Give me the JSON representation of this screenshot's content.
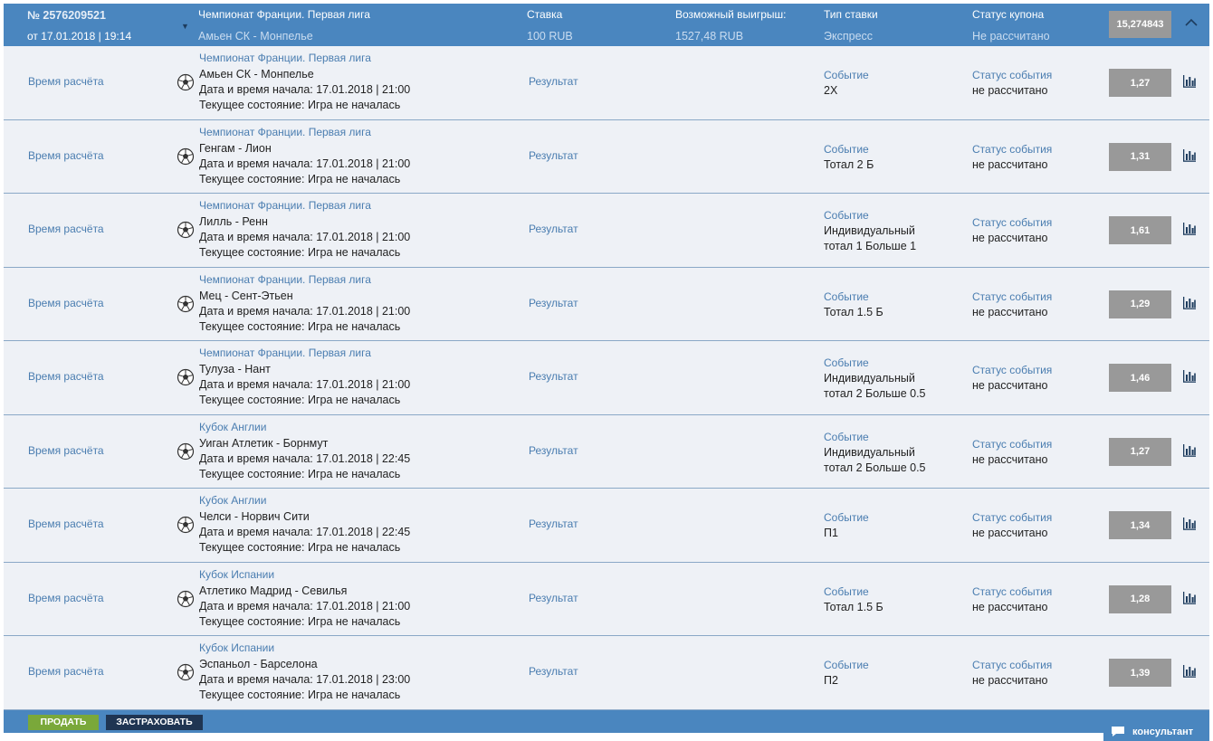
{
  "coupon": {
    "number": "№ 2576209521",
    "date": "от 17.01.2018 | 19:14",
    "col_event_label": "Чемпионат Франции. Первая лига",
    "col_event_value": "Амьен СК - Монпелье",
    "col_stake_label": "Ставка",
    "col_stake_value": "100 RUB",
    "col_win_label": "Возможный выигрыш:",
    "col_win_value": "1527,48 RUB",
    "col_type_label": "Тип ставки",
    "col_type_value": "Экспресс",
    "col_status_label": "Статус купона",
    "col_status_value": "Не рассчитано",
    "total_odds": "15,274843",
    "toggle_icon": "chevron-up-icon"
  },
  "labels": {
    "calc_time": "Время расчёта",
    "result": "Результат",
    "event": "Событие",
    "event_status": "Статус события",
    "start_prefix": "Дата и время начала: ",
    "state_prefix": "Текущее состояние: "
  },
  "bets": [
    {
      "league": "Чемпионат Франции. Первая лига",
      "teams": "Амьен СК - Монпелье",
      "start": "Дата и время начала: 17.01.2018 | 21:00",
      "state": "Текущее состояние: Игра не началась",
      "event_lines": [
        "2Х"
      ],
      "status": "не рассчитано",
      "odds": "1,27"
    },
    {
      "league": "Чемпионат Франции. Первая лига",
      "teams": "Генгам - Лион",
      "start": "Дата и время начала: 17.01.2018 | 21:00",
      "state": "Текущее состояние: Игра не началась",
      "event_lines": [
        "Тотал 2 Б"
      ],
      "status": "не рассчитано",
      "odds": "1,31"
    },
    {
      "league": "Чемпионат Франции. Первая лига",
      "teams": "Лилль - Ренн",
      "start": "Дата и время начала: 17.01.2018 | 21:00",
      "state": "Текущее состояние: Игра не началась",
      "event_lines": [
        "Индивидуальный",
        "тотал 1 Больше 1"
      ],
      "status": "не рассчитано",
      "odds": "1,61"
    },
    {
      "league": "Чемпионат Франции. Первая лига",
      "teams": "Мец - Сент-Этьен",
      "start": "Дата и время начала: 17.01.2018 | 21:00",
      "state": "Текущее состояние: Игра не началась",
      "event_lines": [
        "Тотал 1.5 Б"
      ],
      "status": "не рассчитано",
      "odds": "1,29"
    },
    {
      "league": "Чемпионат Франции. Первая лига",
      "teams": "Тулуза - Нант",
      "start": "Дата и время начала: 17.01.2018 | 21:00",
      "state": "Текущее состояние: Игра не началась",
      "event_lines": [
        "Индивидуальный",
        "тотал 2 Больше 0.5"
      ],
      "status": "не рассчитано",
      "odds": "1,46"
    },
    {
      "league": "Кубок Англии",
      "teams": "Уиган Атлетик - Борнмут",
      "start": "Дата и время начала: 17.01.2018 | 22:45",
      "state": "Текущее состояние: Игра не началась",
      "event_lines": [
        "Индивидуальный",
        "тотал 2 Больше 0.5"
      ],
      "status": "не рассчитано",
      "odds": "1,27"
    },
    {
      "league": "Кубок Англии",
      "teams": "Челси - Норвич Сити",
      "start": "Дата и время начала: 17.01.2018 | 22:45",
      "state": "Текущее состояние: Игра не началась",
      "event_lines": [
        "П1"
      ],
      "status": "не рассчитано",
      "odds": "1,34"
    },
    {
      "league": "Кубок Испании",
      "teams": "Атлетико Мадрид - Севилья",
      "start": "Дата и время начала: 17.01.2018 | 21:00",
      "state": "Текущее состояние: Игра не началась",
      "event_lines": [
        "Тотал 1.5 Б"
      ],
      "status": "не рассчитано",
      "odds": "1,28"
    },
    {
      "league": "Кубок Испании",
      "teams": "Эспаньол - Барселона",
      "start": "Дата и время начала: 17.01.2018 | 23:00",
      "state": "Текущее состояние: Игра не началась",
      "event_lines": [
        "П2"
      ],
      "status": "не рассчитано",
      "odds": "1,39"
    }
  ],
  "footer": {
    "sell_label": "ПРОДАТЬ",
    "insure_label": "ЗАСТРАХОВАТЬ"
  },
  "consultant": {
    "label": "консультант",
    "icon": "chat-bubble-icon"
  },
  "colors": {
    "header_bg": "#4a86bf",
    "row_bg": "#eef1f6",
    "link_blue": "#4a7db0",
    "odds_bg": "#999999",
    "sell_green": "#7aa83a",
    "insure_navy": "#1f3552"
  }
}
